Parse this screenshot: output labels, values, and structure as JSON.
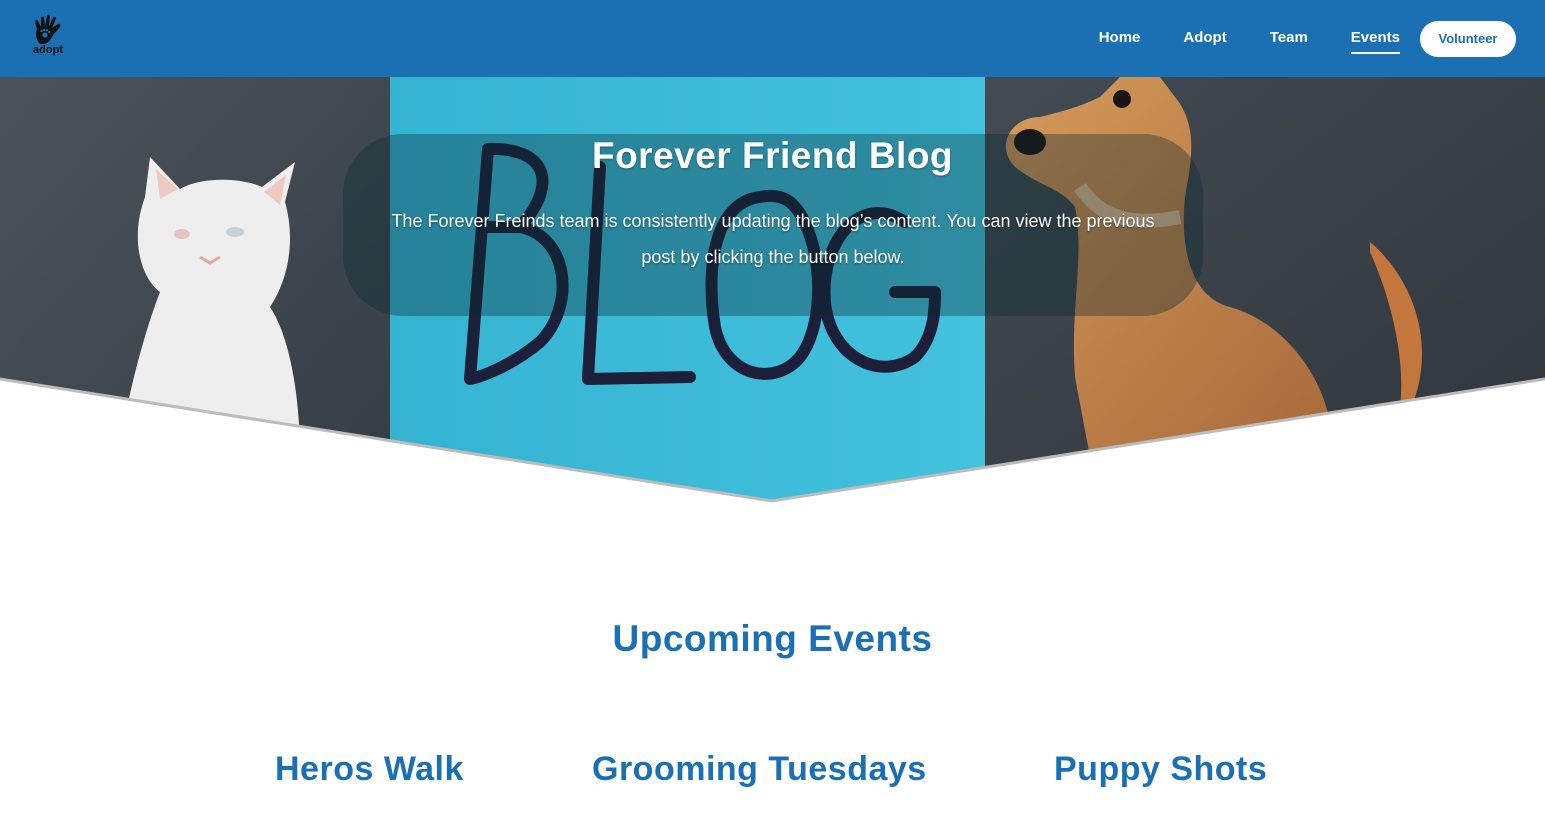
{
  "logo": {
    "text": "adopt",
    "icon": "paw-hand-icon"
  },
  "nav": {
    "items": [
      {
        "label": "Home",
        "active": false
      },
      {
        "label": "Adopt",
        "active": false
      },
      {
        "label": "Team",
        "active": false
      },
      {
        "label": "Events",
        "active": true
      }
    ],
    "cta_label": "Volunteer"
  },
  "hero": {
    "title": "Forever Friend Blog",
    "description": "The Forever Freinds team is consistently updating the blog’s content. You can view the previous post by clicking the button below.",
    "sign_text": "BLOG"
  },
  "events": {
    "heading": "Upcoming Events",
    "items": [
      {
        "title": "Heros Walk"
      },
      {
        "title": "Grooming Tuesdays"
      },
      {
        "title": "Puppy Shots"
      }
    ]
  },
  "colors": {
    "brand_blue": "#1a70b2",
    "sign_cyan": "#38b8d6",
    "wall_gray": "#3e474e"
  }
}
